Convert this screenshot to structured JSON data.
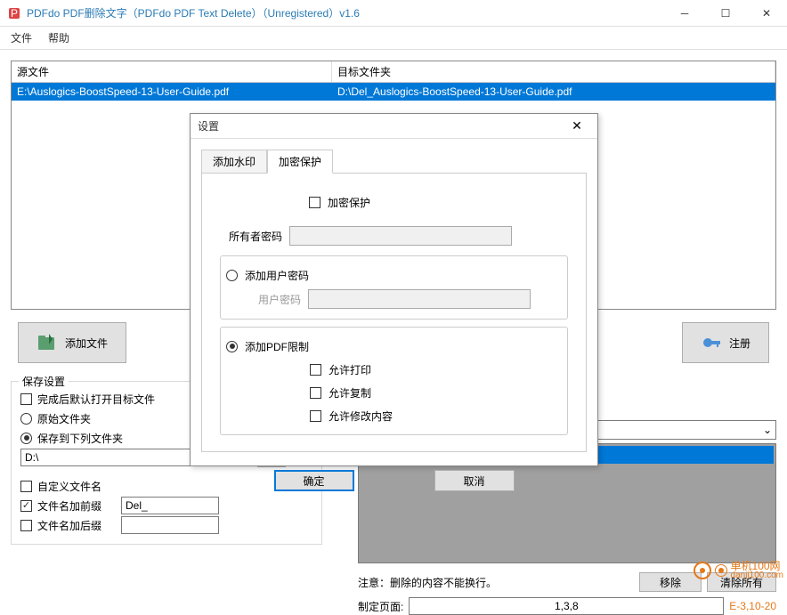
{
  "window": {
    "title": "PDFdo PDF删除文字（PDFdo PDF Text Delete）（Unregistered）v1.6"
  },
  "menu": {
    "file": "文件",
    "help": "帮助"
  },
  "table": {
    "col1": "源文件",
    "col2": "目标文件夹",
    "row1": {
      "src": "E:\\Auslogics-BoostSpeed-13-User-Guide.pdf",
      "dst": "D:\\Del_Auslogics-BoostSpeed-13-User-Guide.pdf"
    }
  },
  "buttons": {
    "addFile": "添加文件",
    "register": "注册",
    "browse": "...",
    "remove": "移除",
    "clearAll": "清除所有"
  },
  "save": {
    "legend": "保存设置",
    "openAfter": "完成后默认打开目标文件",
    "origFolder": "原始文件夹",
    "saveToFolder": "保存到下列文件夹",
    "path": "D:\\",
    "customName": "自定义文件名",
    "prefix": "文件名加前缀",
    "prefixVal": "Del_",
    "suffix": "文件名加后缀"
  },
  "notice": {
    "text": "注意：删除的内容不能换行。",
    "pageLabel": "制定页面:",
    "pageVal": "1,3,8",
    "example": "E-3,10-20"
  },
  "dialog": {
    "title": "设置",
    "tab1": "添加水印",
    "tab2": "加密保护",
    "encryptProtect": "加密保护",
    "ownerPwd": "所有者密码",
    "addUserPwd": "添加用户密码",
    "userPwd": "用户密码",
    "addPdfLimit": "添加PDF限制",
    "allowPrint": "允许打印",
    "allowCopy": "允许复制",
    "allowModify": "允许修改内容",
    "ok": "确定",
    "cancel": "取消"
  },
  "watermark": {
    "text": "单机100网",
    "url": "danji100.com"
  }
}
